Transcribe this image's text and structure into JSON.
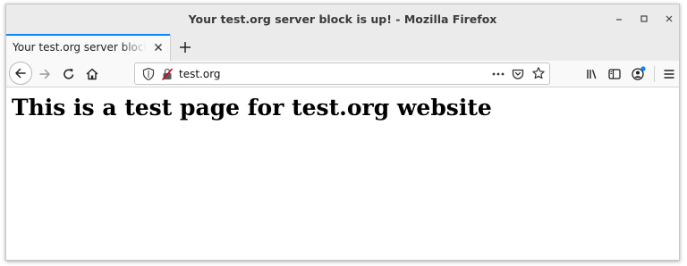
{
  "window": {
    "title": "Your test.org server block is up! - Mozilla Firefox"
  },
  "tabs": [
    {
      "label": "Your test.org server block is up!",
      "active": true
    }
  ],
  "toolbar": {
    "url": "test.org",
    "icons": [
      "back-arrow-icon",
      "forward-arrow-icon",
      "reload-icon",
      "home-icon",
      "shield-icon",
      "insecure-lock-icon",
      "more-dots-icon",
      "pocket-icon",
      "bookmark-star-icon",
      "library-icon",
      "sidebar-icon",
      "account-icon",
      "hamburger-menu-icon"
    ]
  },
  "page": {
    "heading": "This is a test page for test.org website"
  },
  "colors": {
    "accent": "#0a84ff",
    "chrome": "#ebebeb",
    "toolbar": "#f9f9fa",
    "insecure": "#d70022"
  }
}
